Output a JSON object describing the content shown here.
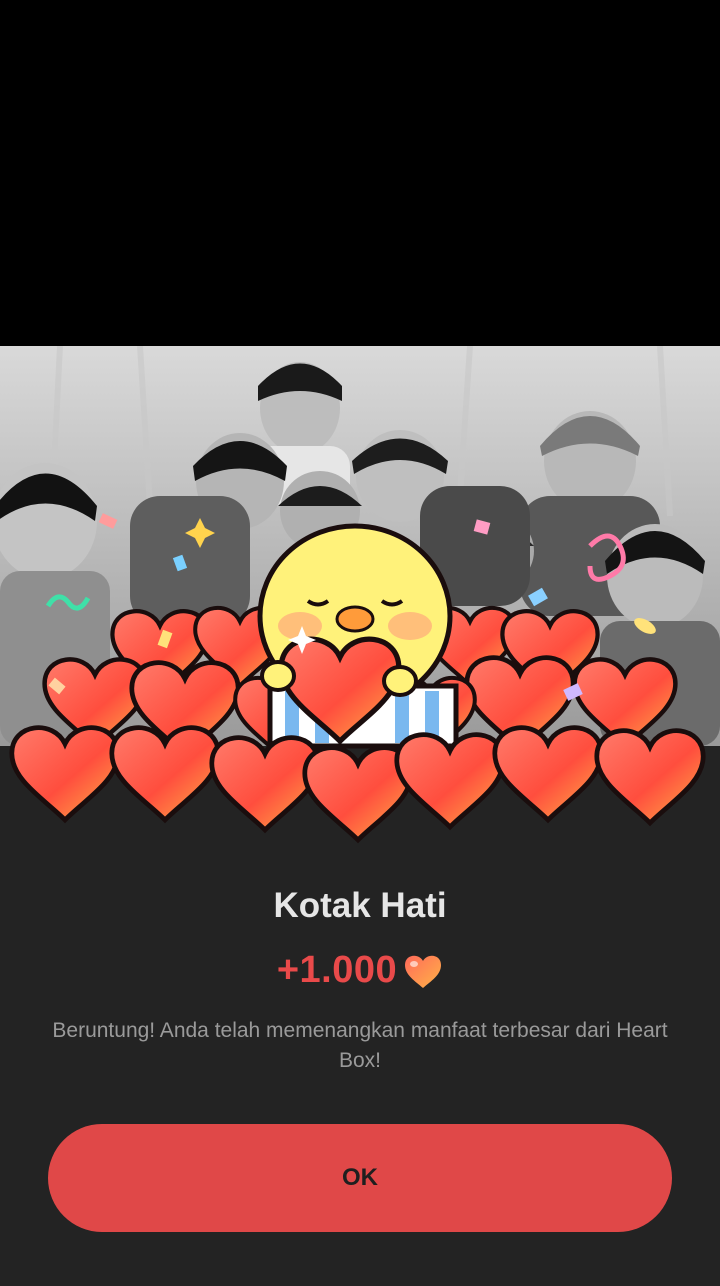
{
  "dialog": {
    "title": "Kotak Hati",
    "amount": "+1.000",
    "message": "Beruntung! Anda telah memenangkan manfaat terbesar dari Heart Box!",
    "ok_label": "OK"
  },
  "colors": {
    "sheet_background": "#232323",
    "accent": "#e04848",
    "amount_text": "#e94a4a",
    "title_text": "#e6e6e6",
    "message_text": "#9a9a9a"
  },
  "icons": {
    "amount_icon": "heart-icon",
    "illustration": "chick-with-heart-gift-illustration"
  }
}
